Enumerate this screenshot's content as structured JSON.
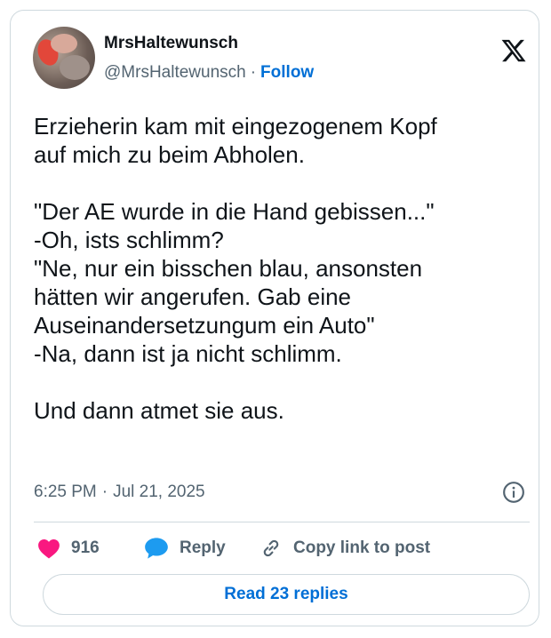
{
  "author": {
    "name": "MrsHaltewunsch",
    "handle": "@MrsHaltewunsch",
    "separator": "·",
    "follow_label": "Follow"
  },
  "tweet": {
    "text": "Erzieherin kam mit eingezogenem Kopf\nauf mich zu beim Abholen.\n\n\"Der AE wurde in die Hand gebissen...\"\n-Oh, ists schlimm?\n\"Ne, nur ein bisschen blau, ansonsten\nhätten wir angerufen. Gab eine\nAuseinandersetzungum ein Auto\"\n-Na, dann ist ja nicht schlimm.\n\nUnd dann atmet sie aus.",
    "time": "6:25 PM",
    "date_separator": "·",
    "date": "Jul 21, 2025"
  },
  "actions": {
    "like_count": "916",
    "reply_label": "Reply",
    "copy_link_label": "Copy link to post"
  },
  "footer": {
    "read_replies_label": "Read 23 replies"
  },
  "icons": {
    "logo": "x-logo-icon",
    "info": "info-icon",
    "like": "heart-icon",
    "reply": "speech-bubble-icon",
    "copy_link": "link-icon"
  },
  "colors": {
    "link_blue": "#006fd6",
    "heart_pink": "#f91880",
    "reply_blue": "#1d9bf0",
    "muted_text": "#536471",
    "border": "#cfd9de"
  }
}
